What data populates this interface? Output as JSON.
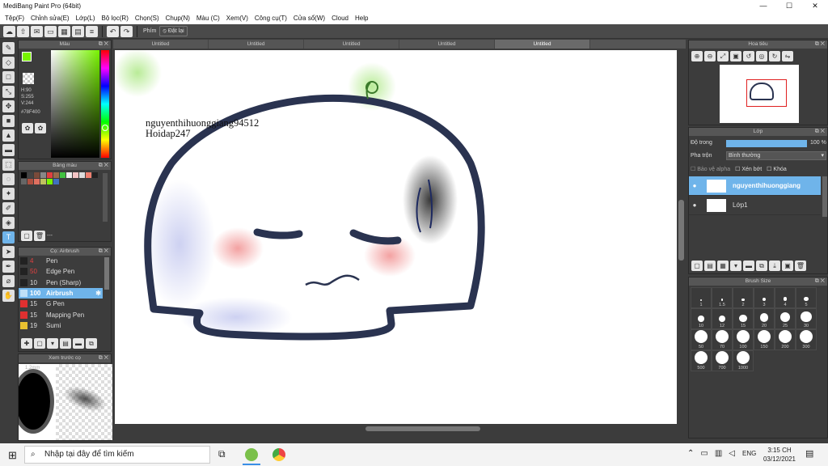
{
  "window": {
    "title": "MediBang Paint Pro (64bit)",
    "min": "—",
    "max": "☐",
    "close": "✕"
  },
  "menu": [
    "Tệp(F)",
    "Chỉnh sửa(E)",
    "Lớp(L)",
    "Bộ lọc(R)",
    "Chọn(S)",
    "Chụp(N)",
    "Màu (C)",
    "Xem(V)",
    "Công cụ(T)",
    "Cửa sổ(W)",
    "Cloud",
    "Help"
  ],
  "toolbar": {
    "key_label": "Phím",
    "reset_label": "Đặt lại"
  },
  "tabs": [
    "Untitled",
    "Untitled",
    "Untitled",
    "Untitled",
    "Untitled"
  ],
  "color_panel": {
    "title": "Màu",
    "h": "H:90",
    "s": "S:255",
    "v": "V:244",
    "hex": "#78F400",
    "current_color": "#78F400"
  },
  "palette_panel": {
    "title": "Bảng màu",
    "footer": "---"
  },
  "brush_panel": {
    "title": "Cọ: Airbrush",
    "items": [
      {
        "size": "4",
        "name": "Pen",
        "color": "#222222"
      },
      {
        "size": "50",
        "name": "Edge Pen",
        "color": "#222222"
      },
      {
        "size": "10",
        "name": "Pen (Sharp)",
        "color": "#222222"
      },
      {
        "size": "100",
        "name": "Airbrush",
        "color": "#6fb4ea"
      },
      {
        "size": "15",
        "name": "G Pen",
        "color": "#e03030"
      },
      {
        "size": "15",
        "name": "Mapping Pen",
        "color": "#e03030"
      },
      {
        "size": "19",
        "name": "Sumi",
        "color": "#e8c030"
      }
    ]
  },
  "preview_panel": {
    "title": "Xem trước cọ",
    "brush_size": "1.2mm"
  },
  "canvas": {
    "text_line1": "nguyenthihuonggiang94512",
    "text_line2": "Hoidap247"
  },
  "navigator": {
    "title": "Hoa tiêu"
  },
  "layer_panel": {
    "title": "Lớp",
    "opacity_label": "Độ trong",
    "opacity_value": "100 %",
    "opacity": 1.0,
    "blend_label": "Pha trộn",
    "blend_value": "Bình thường",
    "protect_alpha": "Bảo vệ alpha",
    "clipping": "Xén bớt",
    "lock": "Khóa",
    "layers": [
      {
        "name": "nguyenthihuonggiang"
      },
      {
        "name": "Lớp1"
      }
    ]
  },
  "brush_size_panel": {
    "title": "Brush Size",
    "sizes": [
      "1",
      "1.5",
      "2",
      "3",
      "4",
      "5",
      "10",
      "12",
      "15",
      "20",
      "25",
      "30",
      "50",
      "70",
      "100",
      "150",
      "200",
      "300",
      "500",
      "700",
      "1000"
    ]
  },
  "taskbar": {
    "search_placeholder": "Nhập tại đây để tìm kiếm",
    "language": "ENG",
    "time": "3:15 CH",
    "date": "03/12/2021"
  }
}
